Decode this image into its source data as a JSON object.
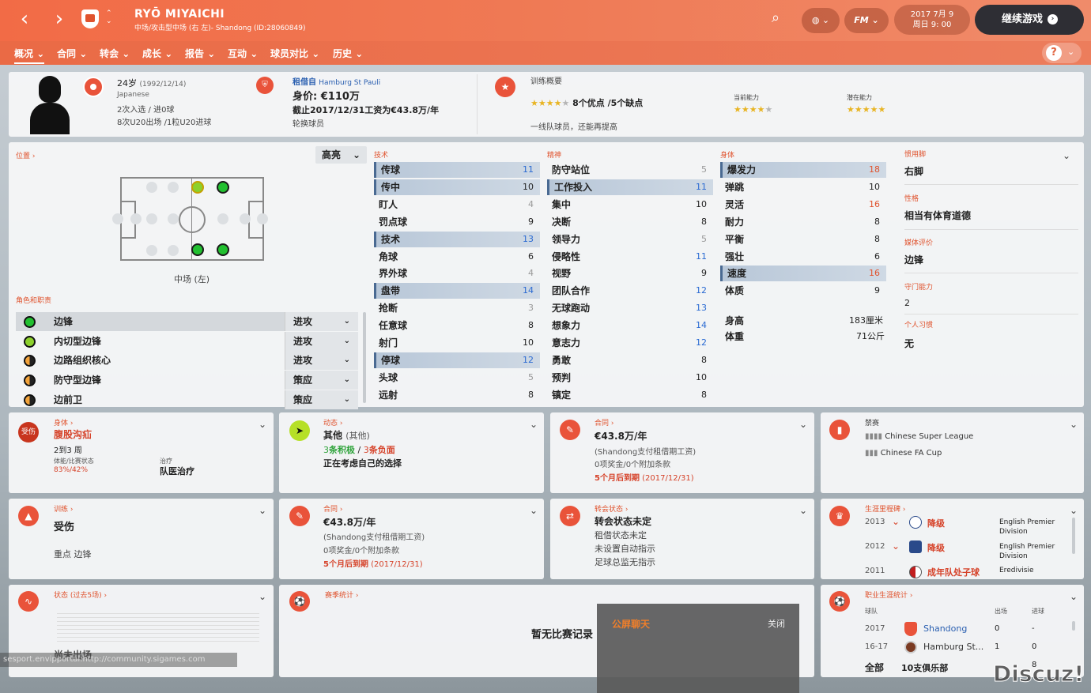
{
  "header": {
    "player_name": "RYŌ MIYAICHI",
    "player_sub": "中场/攻击型中场 (右 左)- Shandong (ID:28060849)",
    "date_line1": "2017 7月 9",
    "date_line2": "周日 9: 00",
    "continue_label": "继续游戏",
    "fm_label": "FM"
  },
  "menu": [
    "概况",
    "合同",
    "转会",
    "成长",
    "报告",
    "互动",
    "球员对比",
    "历史"
  ],
  "profile": {
    "age": "24岁",
    "dob": "(1992/12/14)",
    "nationality": "Japanese",
    "caps": "2次入选 / 进0球",
    "u20": "8次U20出场 /1粒U20进球",
    "loan_from_prefix": "租借自",
    "loan_from": "Hamburg St Pauli",
    "value_label": "身价: €110万",
    "wage_line": "截止2017/12/31工资为€43.8万/年",
    "status": "轮换球员"
  },
  "training_overview": {
    "title": "训练概要",
    "strengths": "8个优点 /5个缺点",
    "note": "一线队球员，还能再提高",
    "current_label": "当前能力",
    "potential_label": "潜在能力",
    "summary_stars": 3.5,
    "current_stars": 3.5,
    "potential_stars": 4.5
  },
  "position": {
    "header": "位置",
    "highlight_label": "高亮",
    "label": "中场 (左)",
    "roles_header": "角色和职责",
    "roles": [
      {
        "name": "边锋",
        "duty": "进攻",
        "color": "#22c030"
      },
      {
        "name": "内切型边锋",
        "duty": "进攻",
        "color": "#8cd02c"
      },
      {
        "name": "边路组织核心",
        "duty": "进攻",
        "color": "#f2a23a"
      },
      {
        "name": "防守型边锋",
        "duty": "策应",
        "color": "#f2a23a"
      },
      {
        "name": "边前卫",
        "duty": "策应",
        "color": "#f2a23a"
      }
    ]
  },
  "attributes": {
    "technical_header": "技术",
    "mental_header": "精神",
    "physical_header": "身体",
    "technical": [
      {
        "name": "传球",
        "value": "11",
        "hl": true,
        "c": "b"
      },
      {
        "name": "传中",
        "value": "10",
        "hl": true,
        "c": ""
      },
      {
        "name": "盯人",
        "value": "4",
        "hl": false,
        "c": "g"
      },
      {
        "name": "罚点球",
        "value": "9",
        "hl": false,
        "c": ""
      },
      {
        "name": "技术",
        "value": "13",
        "hl": true,
        "c": "b"
      },
      {
        "name": "角球",
        "value": "6",
        "hl": false,
        "c": ""
      },
      {
        "name": "界外球",
        "value": "4",
        "hl": false,
        "c": "g"
      },
      {
        "name": "盘带",
        "value": "14",
        "hl": true,
        "c": "b"
      },
      {
        "name": "抢断",
        "value": "3",
        "hl": false,
        "c": "g"
      },
      {
        "name": "任意球",
        "value": "8",
        "hl": false,
        "c": ""
      },
      {
        "name": "射门",
        "value": "10",
        "hl": false,
        "c": ""
      },
      {
        "name": "停球",
        "value": "12",
        "hl": true,
        "c": "b"
      },
      {
        "name": "头球",
        "value": "5",
        "hl": false,
        "c": "g"
      },
      {
        "name": "远射",
        "value": "8",
        "hl": false,
        "c": ""
      }
    ],
    "mental": [
      {
        "name": "防守站位",
        "value": "5",
        "hl": false,
        "c": "g"
      },
      {
        "name": "工作投入",
        "value": "11",
        "hl": true,
        "c": "b"
      },
      {
        "name": "集中",
        "value": "10",
        "hl": false,
        "c": ""
      },
      {
        "name": "决断",
        "value": "8",
        "hl": false,
        "c": ""
      },
      {
        "name": "领导力",
        "value": "5",
        "hl": false,
        "c": "g"
      },
      {
        "name": "侵略性",
        "value": "11",
        "hl": false,
        "c": "b"
      },
      {
        "name": "视野",
        "value": "9",
        "hl": false,
        "c": ""
      },
      {
        "name": "团队合作",
        "value": "12",
        "hl": false,
        "c": "b"
      },
      {
        "name": "无球跑动",
        "value": "13",
        "hl": false,
        "c": "b"
      },
      {
        "name": "想象力",
        "value": "14",
        "hl": false,
        "c": "b"
      },
      {
        "name": "意志力",
        "value": "12",
        "hl": false,
        "c": "b"
      },
      {
        "name": "勇敢",
        "value": "8",
        "hl": false,
        "c": ""
      },
      {
        "name": "预判",
        "value": "10",
        "hl": false,
        "c": ""
      },
      {
        "name": "镇定",
        "value": "8",
        "hl": false,
        "c": ""
      }
    ],
    "physical": [
      {
        "name": "爆发力",
        "value": "18",
        "hl": true,
        "c": "r"
      },
      {
        "name": "弹跳",
        "value": "10",
        "hl": false,
        "c": ""
      },
      {
        "name": "灵活",
        "value": "16",
        "hl": false,
        "c": "r"
      },
      {
        "name": "耐力",
        "value": "8",
        "hl": false,
        "c": ""
      },
      {
        "name": "平衡",
        "value": "8",
        "hl": false,
        "c": ""
      },
      {
        "name": "强壮",
        "value": "6",
        "hl": false,
        "c": ""
      },
      {
        "name": "速度",
        "value": "16",
        "hl": true,
        "c": "r"
      },
      {
        "name": "体质",
        "value": "9",
        "hl": false,
        "c": ""
      }
    ],
    "height_label": "身高",
    "height": "183厘米",
    "weight_label": "体重",
    "weight": "71公斤"
  },
  "side_info": {
    "foot_label": "惯用脚",
    "foot": "右脚",
    "personality_label": "性格",
    "personality": "相当有体育道德",
    "media_label": "媒体评价",
    "media": "边锋",
    "gk_label": "守门能力",
    "gk": "2",
    "habits_label": "个人习惯",
    "habits": "无"
  },
  "cards": {
    "injury": {
      "header": "身体",
      "title": "腹股沟疝",
      "weeks": "2到3 周",
      "fitness_label": "体能/比赛状态",
      "fitness": "83%/42%",
      "treatment_label": "治疗",
      "treatment": "队医治疗",
      "badge": "受伤"
    },
    "dynamics": {
      "header": "动态",
      "title": "其他",
      "title_sub": "(其他)",
      "pos_count": "3",
      "pos_label": "条积极",
      "neg_count": "3",
      "neg_label": "条负面",
      "line": "正在考虑自己的选择"
    },
    "contract1": {
      "header": "合同",
      "wage": "€43.8万/年",
      "line1": "(Shandong支付租借期工资)",
      "line2": "0项奖金/0个附加条款",
      "expiry": "5个月后到期",
      "expiry_date": "(2017/12/31)"
    },
    "bans": {
      "header": "禁赛",
      "c1": "Chinese Super League",
      "c2": "Chinese FA Cup"
    },
    "training": {
      "header": "训练",
      "status": "受伤",
      "focus": "重点  边锋"
    },
    "contract2": {
      "header": "合同",
      "wage": "€43.8万/年",
      "line1": "(Shandong支付租借期工资)",
      "line2": "0项奖金/0个附加条款",
      "expiry": "5个月后到期",
      "expiry_date": "(2017/12/31)"
    },
    "transfer": {
      "header": "转会状态",
      "status": "转会状态未定",
      "l1": "租借状态未定",
      "l2": "未设置自动指示",
      "l3": "足球总监无指示"
    },
    "milestones": {
      "header": "生涯里程碑",
      "rows": [
        {
          "year": "2013",
          "event": "降级",
          "comp": "English Premier Division"
        },
        {
          "year": "2012",
          "event": "降级",
          "comp": "English Premier Division"
        },
        {
          "year": "2011",
          "event": "成年队处子球",
          "comp": "Eredivisie"
        }
      ]
    },
    "form": {
      "header": "状态 (过去5场)",
      "empty": "尚未出场"
    },
    "season": {
      "header": "赛季统计",
      "empty": "暂无比赛记录"
    },
    "career": {
      "header": "职业生涯统计",
      "col_club": "球队",
      "col_apps": "出场",
      "col_goals": "进球",
      "rows": [
        {
          "season": "2017",
          "club": "Shandong",
          "apps": "0",
          "goals": "-"
        },
        {
          "season": "16-17",
          "club": "Hamburg St...",
          "apps": "1",
          "goals": "0"
        }
      ],
      "total_label": "全部",
      "total": "10支俱乐部",
      "total_apps": "8"
    }
  },
  "chat": {
    "title": "公屏聊天",
    "close": "关闭"
  },
  "watermark": "Discuz!",
  "url_watermark": "sesport.envipportal:http://community.sigames.com"
}
